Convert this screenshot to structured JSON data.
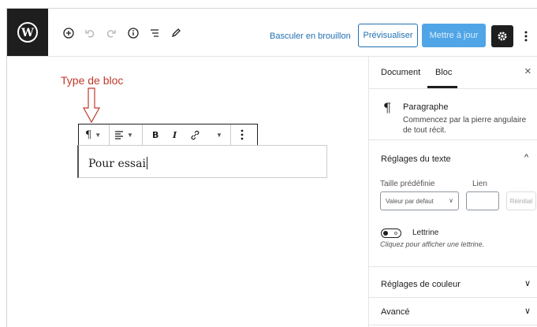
{
  "header": {
    "switch_draft": "Basculer en brouillon",
    "preview": "Prévisualiser",
    "update": "Mettre à jour",
    "icons": [
      "wordpress-logo-icon",
      "add-block-icon",
      "undo-icon",
      "redo-icon",
      "info-icon",
      "list-view-icon",
      "edit-tools-icon",
      "gear-icon",
      "more-menu-icon"
    ]
  },
  "annotation": {
    "label": "Type de bloc",
    "color": "#c0392b"
  },
  "block_toolbar": {
    "paragraph_glyph": "¶",
    "bold": "B",
    "italic": "I"
  },
  "block": {
    "text": "Pour essai"
  },
  "sidebar": {
    "tabs": [
      "Document",
      "Bloc"
    ],
    "active_tab": "Bloc",
    "close": "×",
    "block_info": {
      "icon_glyph": "¶",
      "title": "Paragraphe",
      "description": "Commencez par la pierre angulaire de tout récit."
    },
    "text_settings": {
      "title": "Réglages du texte",
      "preset_label": "Taille prédéfinie",
      "preset_value": "Valeur par defaut",
      "custom_label": "Lien",
      "reset": "Réinitial",
      "dropcap_label": "Lettrine",
      "dropcap_help": "Cliquez pour afficher une lettrine.",
      "dropcap_enabled": false
    },
    "color_settings": {
      "title": "Réglages de couleur"
    },
    "advanced": {
      "title": "Avancé"
    }
  },
  "colors": {
    "accent": "#2271b1",
    "update_button": "#50a5e6",
    "dark": "#1e1e1e"
  }
}
